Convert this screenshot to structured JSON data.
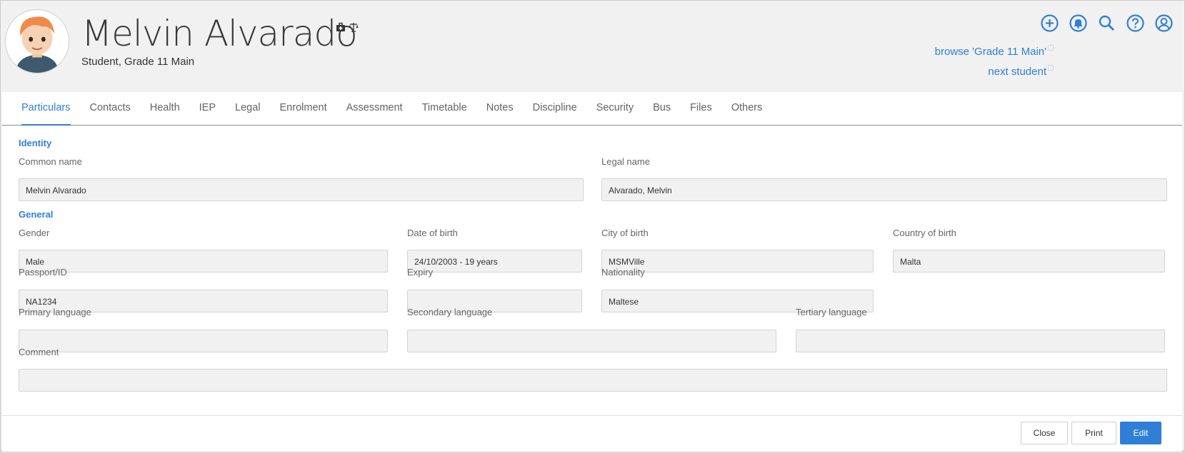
{
  "header": {
    "student_name": "Melvin Alvarado",
    "subtitle": "Student, Grade 11 Main",
    "name_icons": [
      "medical-kit-icon",
      "scales-icon"
    ],
    "top_icons": [
      "add-circle-icon",
      "bell-icon",
      "search-icon",
      "help-icon",
      "user-icon"
    ],
    "browse_link": "browse 'Grade 11 Main'",
    "next_link": "next student",
    "accent_color": "#2f7fd6"
  },
  "tabs": [
    "Particulars",
    "Contacts",
    "Health",
    "IEP",
    "Legal",
    "Enrolment",
    "Assessment",
    "Timetable",
    "Notes",
    "Discipline",
    "Security",
    "Bus",
    "Files",
    "Others"
  ],
  "active_tab": "Particulars",
  "identity": {
    "title": "Identity",
    "common_name_label": "Common name",
    "common_name": "Melvin Alvarado",
    "legal_name_label": "Legal name",
    "legal_name": "Alvarado, Melvin"
  },
  "general": {
    "title": "General",
    "gender_label": "Gender",
    "gender": "Male",
    "dob_label": "Date of birth",
    "dob": "24/10/2003 - 19 years",
    "city_label": "City of birth",
    "city": "MSMVille",
    "country_label": "Country of birth",
    "country": "Malta",
    "passport_label": "Passport/ID",
    "passport": "NA1234",
    "expiry_label": "Expiry",
    "expiry": "",
    "nationality_label": "Nationality",
    "nationality": "Maltese",
    "primary_lang_label": "Primary language",
    "primary_lang": "",
    "secondary_lang_label": "Secondary language",
    "secondary_lang": "",
    "tertiary_lang_label": "Tertiary language",
    "tertiary_lang": "",
    "comment_label": "Comment",
    "comment": ""
  },
  "footer": {
    "close_label": "Close",
    "print_label": "Print",
    "edit_label": "Edit"
  }
}
